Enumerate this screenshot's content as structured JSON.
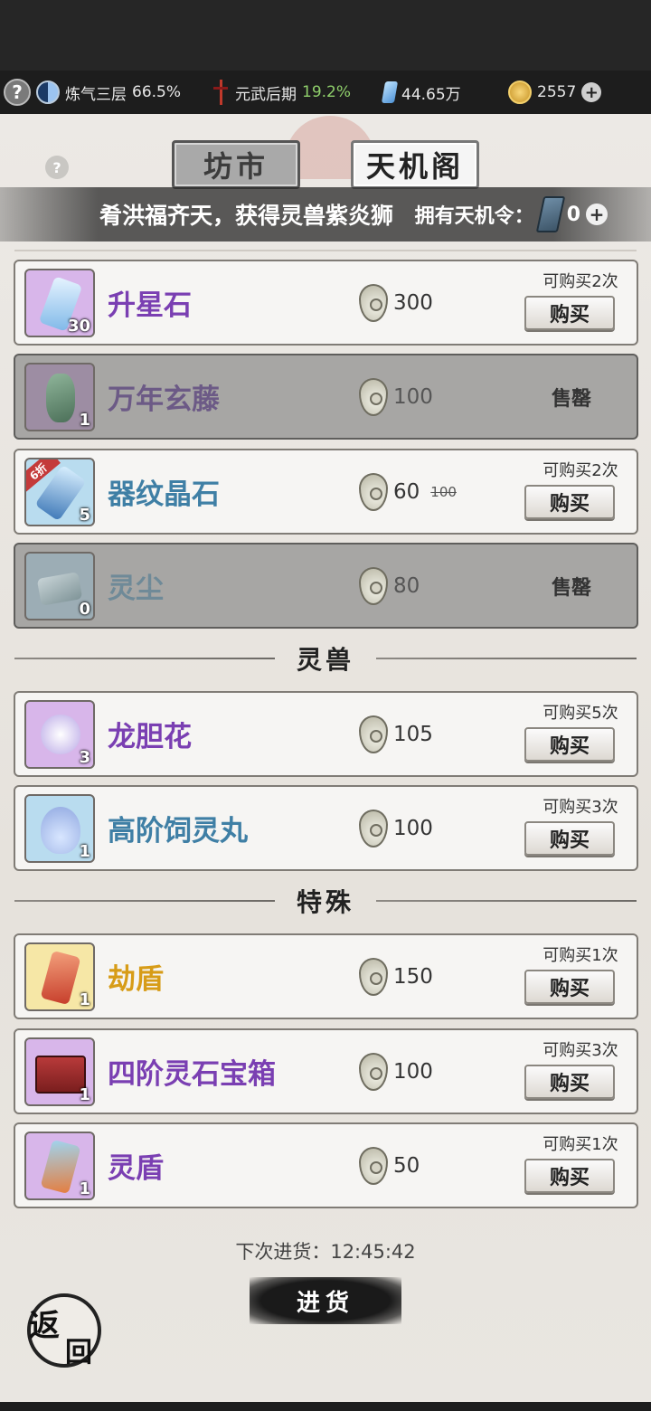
{
  "status_bar": {
    "cultivation": {
      "label": "炼气三层",
      "value": "66.5%"
    },
    "martial": {
      "label": "元武后期",
      "value": "19.2%"
    },
    "spirit_stones": "44.65万",
    "coins": "2557"
  },
  "tabs": {
    "market": "坊市",
    "tianji": "天机阁"
  },
  "banner": {
    "announcement": "肴洪福齐天，获得灵兽紫炎狮",
    "token_label": "拥有天机令：",
    "token_count": "0"
  },
  "items": [
    {
      "name": "升星石",
      "qty": "30",
      "price": "300",
      "limit": "可购买2次",
      "button": "购买"
    },
    {
      "name": "万年玄藤",
      "qty": "1",
      "price": "100",
      "status": "售罄"
    },
    {
      "name": "器纹晶石",
      "qty": "5",
      "price": "60",
      "old_price": "100",
      "discount": "6折",
      "limit": "可购买2次",
      "button": "购买"
    },
    {
      "name": "灵尘",
      "qty": "0",
      "price": "80",
      "status": "售罄"
    }
  ],
  "sections": {
    "beast": "灵兽",
    "special": "特殊"
  },
  "beast_items": [
    {
      "name": "龙胆花",
      "qty": "3",
      "price": "105",
      "limit": "可购买5次",
      "button": "购买"
    },
    {
      "name": "高阶饲灵丸",
      "qty": "1",
      "price": "100",
      "limit": "可购买3次",
      "button": "购买"
    }
  ],
  "special_items": [
    {
      "name": "劫盾",
      "qty": "1",
      "price": "150",
      "limit": "可购买1次",
      "button": "购买"
    },
    {
      "name": "四阶灵石宝箱",
      "qty": "1",
      "price": "100",
      "limit": "可购买3次",
      "button": "购买"
    },
    {
      "name": "灵盾",
      "qty": "1",
      "price": "50",
      "limit": "可购买1次",
      "button": "购买"
    }
  ],
  "restock": {
    "label": "下次进货：",
    "time": "12:45:42",
    "button": "进货"
  },
  "back_button": {
    "char1": "返",
    "char2": "回"
  },
  "colors": {
    "purple_name": "#7a3fb2",
    "blue_name": "#3f7fa5",
    "gold_name": "#d79c17",
    "status_bg": "#1d1d1d"
  }
}
